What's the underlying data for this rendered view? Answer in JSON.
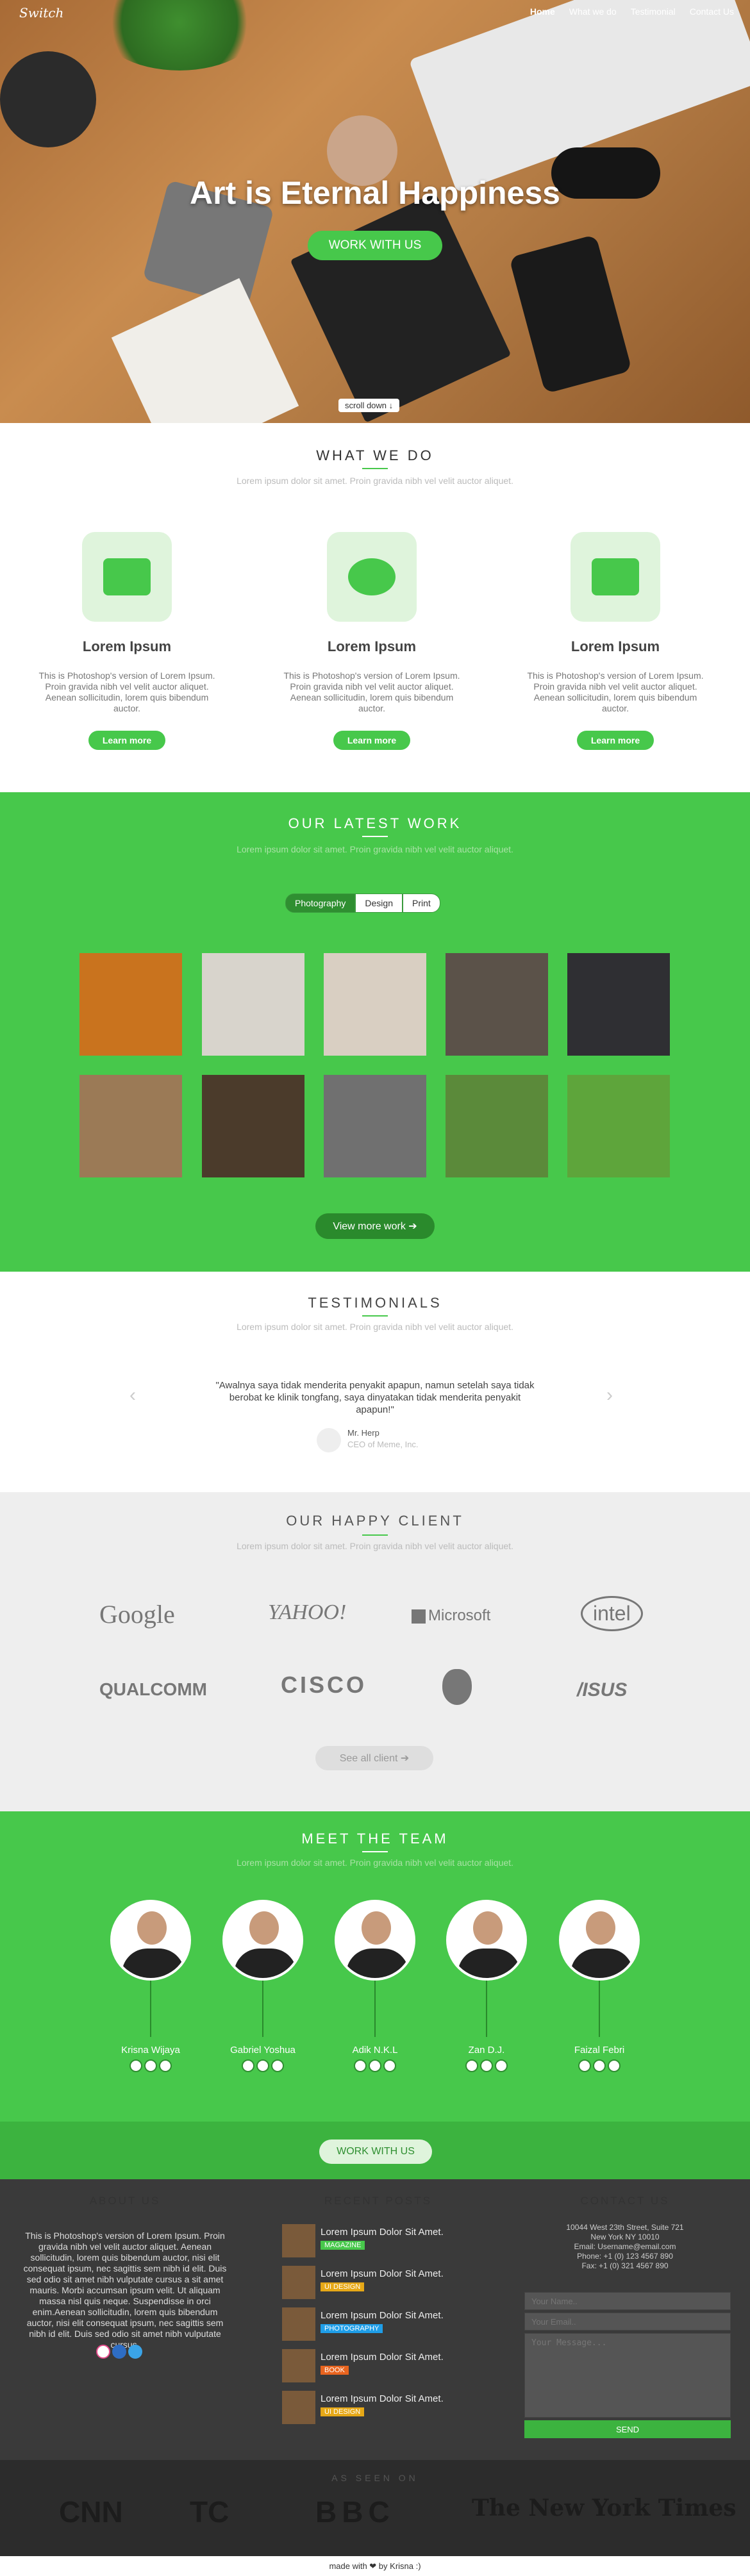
{
  "nav": {
    "logo": "Switch",
    "items": [
      "Home",
      "What we do",
      "Testimonial",
      "Contact Us"
    ]
  },
  "hero": {
    "title": "Art is Eternal Happiness",
    "button": "WORK WITH US",
    "scroll": "scroll down ↓"
  },
  "whatwedo": {
    "title": "WHAT WE DO",
    "subtitle": "Lorem ipsum dolor sit amet. Proin gravida nibh vel velit auctor aliquet.",
    "services": [
      {
        "icon": "camera-icon",
        "heading": "Lorem Ipsum",
        "text": "This is Photoshop's version  of Lorem Ipsum. Proin gravida nibh vel velit auctor aliquet. Aenean sollicitudin, lorem quis bibendum auctor.",
        "button": "Learn more"
      },
      {
        "icon": "dashboard-icon",
        "heading": "Lorem Ipsum",
        "text": "This is Photoshop's version  of Lorem Ipsum. Proin gravida nibh vel velit auctor aliquet. Aenean sollicitudin, lorem quis bibendum auctor.",
        "button": "Learn more"
      },
      {
        "icon": "briefcase-icon",
        "heading": "Lorem Ipsum",
        "text": "This is Photoshop's version  of Lorem Ipsum. Proin gravida nibh vel velit auctor aliquet. Aenean sollicitudin, lorem quis bibendum auctor.",
        "button": "Learn more"
      }
    ]
  },
  "work": {
    "title": "OUR LATEST WORK",
    "subtitle": "Lorem ipsum dolor sit amet. Proin gravida nibh vel velit auctor aliquet.",
    "filters": [
      "Photography",
      "Design",
      "Print"
    ],
    "button": "View more work ➔",
    "colors": [
      "#c9731e",
      "#d8d4cc",
      "#d9cfc2",
      "#5b5249",
      "#2f2f33",
      "#9b7a56",
      "#4b3b2b",
      "#707070",
      "#5b8a3a",
      "#5ea53b"
    ]
  },
  "testimonials": {
    "title": "TESTIMONIALS",
    "subtitle": "Lorem ipsum dolor sit amet. Proin gravida nibh vel velit auctor aliquet.",
    "quote": "\"Awalnya saya tidak menderita penyakit apapun, namun setelah saya tidak berobat ke klinik tongfang, saya dinyatakan tidak menderita penyakit apapun!\"",
    "author": "Mr. Herp",
    "role": "CEO of Meme, Inc."
  },
  "clients": {
    "title": "OUR HAPPY CLIENT",
    "subtitle": "Lorem ipsum dolor sit amet. Proin gravida nibh vel velit auctor aliquet.",
    "logos": [
      "Google",
      "YAHOO!",
      "Microsoft",
      "intel",
      "QUALCOMM",
      "CISCO",
      "",
      "/ISUS"
    ],
    "button": "See all client ➔"
  },
  "team": {
    "title": "MEET THE TEAM",
    "subtitle": "Lorem ipsum dolor sit amet. Proin gravida nibh vel velit auctor aliquet.",
    "members": [
      "Krisna Wijaya",
      "Gabriel Yoshua",
      "Adik N.K.L",
      "Zan D.J.",
      "Faizal Febri"
    ],
    "button": "WORK WITH US"
  },
  "footer": {
    "about_title": "ABOUT US",
    "about_text": "This is Photoshop's version  of Lorem Ipsum. Proin gravida nibh vel velit auctor aliquet. Aenean sollicitudin, lorem quis bibendum auctor, nisi elit consequat ipsum, nec sagittis sem nibh id elit. Duis sed odio sit amet nibh vulputate cursus a sit amet mauris. Morbi accumsan ipsum velit. Ut aliquam massa nisl quis neque. Suspendisse in orci enim.Aenean sollicitudin, lorem quis bibendum auctor, nisi elit consequat ipsum, nec sagittis sem nibh id elit. Duis sed odio sit amet nibh vulputate cursus.",
    "posts_title": "RECENT POSTS",
    "posts": [
      {
        "title": "Lorem Ipsum Dolor Sit Amet.",
        "tag": "MAGAZINE",
        "color": "#47c84b"
      },
      {
        "title": "Lorem Ipsum Dolor Sit Amet.",
        "tag": "UI DESIGN",
        "color": "#e6a817"
      },
      {
        "title": "Lorem Ipsum Dolor Sit Amet.",
        "tag": "PHOTOGRAPHY",
        "color": "#1f9ee8"
      },
      {
        "title": "Lorem Ipsum Dolor Sit Amet.",
        "tag": "BOOK",
        "color": "#e8641f"
      },
      {
        "title": "Lorem Ipsum Dolor Sit Amet.",
        "tag": "UI DESIGN",
        "color": "#e6a817"
      }
    ],
    "contact_title": "CONTACT US",
    "contact_lines": [
      "10044 West 23th Street, Suite 721",
      "New York NY 10010",
      "Email: Username@email.com",
      "Phone: +1 (0) 123 4567 890",
      "Fax: +1 (0) 321 4567 890"
    ],
    "name_placeholder": "Your Name..",
    "email_placeholder": "Your Email..",
    "message_placeholder": "Your Message...",
    "send": "SEND"
  },
  "seen": {
    "label": "AS SEEN ON",
    "outlets": [
      "CNN",
      "TC",
      "BBC",
      "The New York Times"
    ]
  },
  "made": "made with ❤ by Krisna :)"
}
